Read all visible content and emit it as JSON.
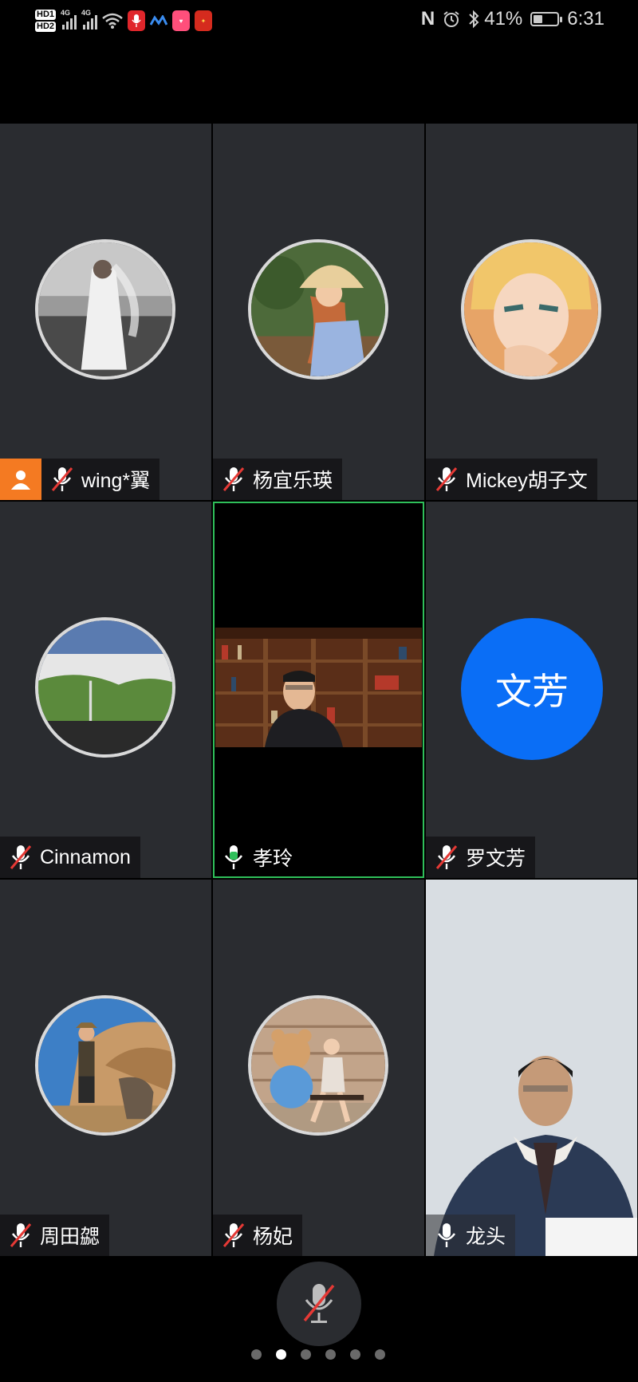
{
  "status_bar": {
    "hd1": "HD1",
    "hd2": "HD2",
    "sig1_label": "4G",
    "sig2_label": "4G",
    "battery_text": "41%",
    "battery_level": 0.41,
    "time": "6:31",
    "nfc": "N"
  },
  "participants": [
    {
      "name": "wing*翼",
      "mic": "muted",
      "host": true
    },
    {
      "name": "杨宜乐瑛",
      "mic": "muted"
    },
    {
      "name": "Mickey胡子文",
      "mic": "muted"
    },
    {
      "name": "Cinnamon",
      "mic": "muted"
    },
    {
      "name": "孝玲",
      "mic": "speaking",
      "active": true
    },
    {
      "name": "罗文芳",
      "mic": "muted",
      "initials": "文芳"
    },
    {
      "name": "周田勰",
      "mic": "muted"
    },
    {
      "name": "杨妃",
      "mic": "muted"
    },
    {
      "name": "龙头",
      "mic": "on"
    }
  ],
  "colors": {
    "tile_bg": "#2a2c30",
    "active_border": "#2fbf5a",
    "host_badge": "#f47a22",
    "initials_avatar": "#0a6ef6",
    "muted_slash": "#e53935"
  },
  "bottom": {
    "mic_state": "muted",
    "page_count": 6,
    "current_page": 2
  }
}
